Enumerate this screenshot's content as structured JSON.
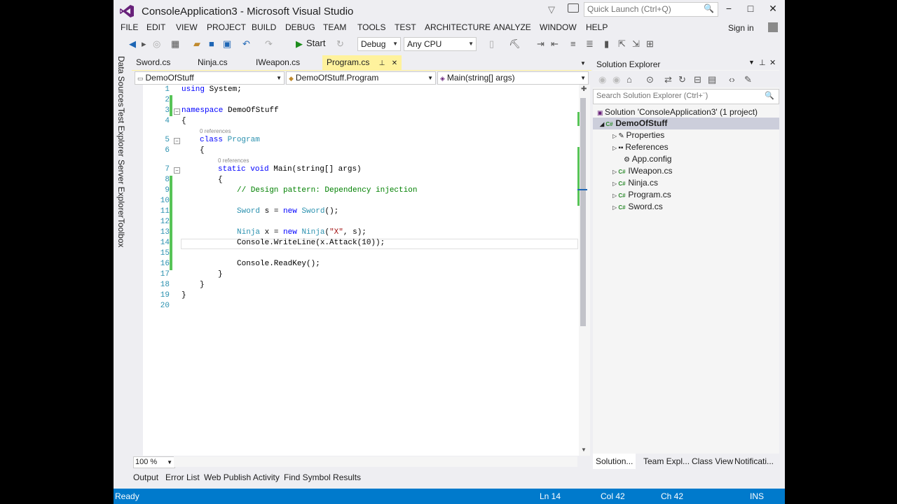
{
  "window": {
    "title": "ConsoleApplication3 - Microsoft Visual Studio",
    "quick_launch_placeholder": "Quick Launch (Ctrl+Q)",
    "min_glyph": "−",
    "max_glyph": "□",
    "close_glyph": "✕"
  },
  "menu": [
    "FILE",
    "EDIT",
    "VIEW",
    "PROJECT",
    "BUILD",
    "DEBUG",
    "TEAM",
    "TOOLS",
    "TEST",
    "ARCHITECTURE",
    "ANALYZE",
    "WINDOW",
    "HELP"
  ],
  "signin": "Sign in",
  "toolbar": {
    "start_label": "Start",
    "config": "Debug",
    "platform": "Any CPU"
  },
  "left_dock": [
    "Data Sources",
    "Test Explorer",
    "Server Explorer",
    "Toolbox"
  ],
  "doc_tabs": [
    "Sword.cs",
    "Ninja.cs",
    "IWeapon.cs",
    "Program.cs"
  ],
  "active_tab_pin": "⊥",
  "nav": {
    "project": "DemoOfStuff",
    "type": "DemoOfStuff.Program",
    "member": "Main(string[] args)"
  },
  "code": {
    "line_numbers": [
      "1",
      "2",
      "3",
      "4",
      "5",
      "6",
      "7",
      "8",
      "9",
      "10",
      "11",
      "12",
      "13",
      "14",
      "15",
      "16",
      "17",
      "18",
      "19",
      "20"
    ],
    "references_label": "0 references",
    "l1_kw": "using",
    "l1_rest": " System;",
    "l3_kw": "namespace",
    "l3_rest": " DemoOfStuff",
    "brace_open": "{",
    "brace_close": "}",
    "l5_kw": "class",
    "l5_type": "Program",
    "l7_kw1": "static",
    "l7_kw2": "void",
    "l7_rest": " Main(string[] args)",
    "l9_comment": "// Design pattern: Dependency injection",
    "l11_t1": "Sword",
    "l11_mid": " s = ",
    "l11_kw": "new",
    "l11_t2": "Sword",
    "l11_end": "();",
    "l13_t1": "Ninja",
    "l13_mid": " x = ",
    "l13_kw": "new",
    "l13_t2": "Ninja",
    "l13_p": "(",
    "l13_str": "\"X\"",
    "l13_end": ", s);",
    "l14_text": "Console.WriteLine(x.Attack(10));",
    "l16_text": "Console.ReadKey();"
  },
  "zoom_level": "100 %",
  "bottom_tabs": [
    "Output",
    "Error List",
    "Web Publish Activity",
    "Find Symbol Results"
  ],
  "solution_explorer": {
    "title": "Solution Explorer",
    "search_placeholder": "Search Solution Explorer (Ctrl+¨)",
    "solution_label": "Solution 'ConsoleApplication3' (1 project)",
    "project": "DemoOfStuff",
    "items": [
      "Properties",
      "References",
      "App.config",
      "IWeapon.cs",
      "Ninja.cs",
      "Program.cs",
      "Sword.cs"
    ],
    "tabs": [
      "Solution...",
      "Team Expl...",
      "Class View",
      "Notificati..."
    ]
  },
  "status": {
    "state": "Ready",
    "line": "Ln 14",
    "col": "Col 42",
    "ch": "Ch 42",
    "mode": "INS"
  },
  "colors": {
    "status_bar": "#007acc",
    "active_tab": "#fff29d",
    "keyword": "#0000ff",
    "type": "#2b91af",
    "comment": "#008000",
    "string": "#a31515",
    "change_marker": "#57c457"
  }
}
